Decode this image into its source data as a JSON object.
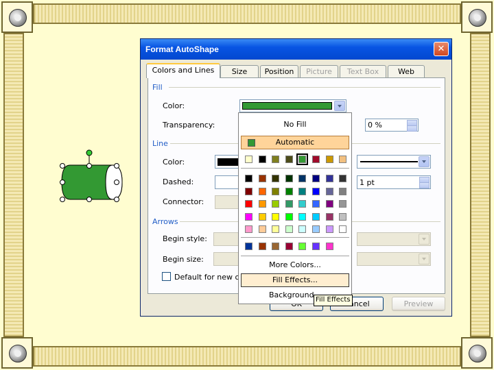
{
  "dialog": {
    "title": "Format AutoShape",
    "close_glyph": "✕",
    "tabs": [
      {
        "label": "Colors and Lines",
        "active": true,
        "disabled": false
      },
      {
        "label": "Size",
        "active": false,
        "disabled": false
      },
      {
        "label": "Position",
        "active": false,
        "disabled": false
      },
      {
        "label": "Picture",
        "active": false,
        "disabled": true
      },
      {
        "label": "Text Box",
        "active": false,
        "disabled": true
      },
      {
        "label": "Web",
        "active": false,
        "disabled": false
      }
    ],
    "fill": {
      "section": "Fill",
      "color_label": "Color:",
      "color_value": "#339933",
      "transparency_label": "Transparency:",
      "transparency_value": "0 %"
    },
    "line": {
      "section": "Line",
      "color_label": "Color:",
      "color_value": "#000000",
      "dashed_label": "Dashed:",
      "connector_label": "Connector:",
      "weight_value": "1 pt"
    },
    "arrows": {
      "section": "Arrows",
      "begin_style_label": "Begin style:",
      "begin_size_label": "Begin size:"
    },
    "default_checkbox_label": "Default for new ob",
    "buttons": {
      "ok": "OK",
      "cancel": "Cancel",
      "preview": "Preview"
    }
  },
  "color_popup": {
    "no_fill": "No Fill",
    "automatic": "Automatic",
    "automatic_color": "#339933",
    "scheme_colors": [
      "#ffffcc",
      "#000000",
      "#7f7f1f",
      "#4d4d1a",
      "#339933",
      "#a00a2a",
      "#cc9900",
      "#f2c080"
    ],
    "standard_colors": [
      [
        "#000000",
        "#993300",
        "#333300",
        "#003300",
        "#003366",
        "#000080",
        "#333399",
        "#333333"
      ],
      [
        "#800000",
        "#ff6600",
        "#808000",
        "#008000",
        "#008080",
        "#0000ff",
        "#666699",
        "#808080"
      ],
      [
        "#ff0000",
        "#ff9900",
        "#99cc00",
        "#339966",
        "#33cccc",
        "#3366ff",
        "#800080",
        "#969696"
      ],
      [
        "#ff00ff",
        "#ffcc00",
        "#ffff00",
        "#00ff00",
        "#00ffff",
        "#00ccff",
        "#993366",
        "#c0c0c0"
      ],
      [
        "#ff99cc",
        "#ffcc99",
        "#ffff99",
        "#ccffcc",
        "#ccffff",
        "#99ccff",
        "#cc99ff",
        "#ffffff"
      ]
    ],
    "recent_colors": [
      "#003399",
      "#993300",
      "#996633",
      "#990033",
      "#66ff33",
      "#6633ff",
      "#ff33cc"
    ],
    "more_colors": "More Colors...",
    "fill_effects": "Fill Effects...",
    "background": "Background...",
    "tooltip": "Fill Effects"
  },
  "shape": {
    "fill_color": "#339933"
  }
}
